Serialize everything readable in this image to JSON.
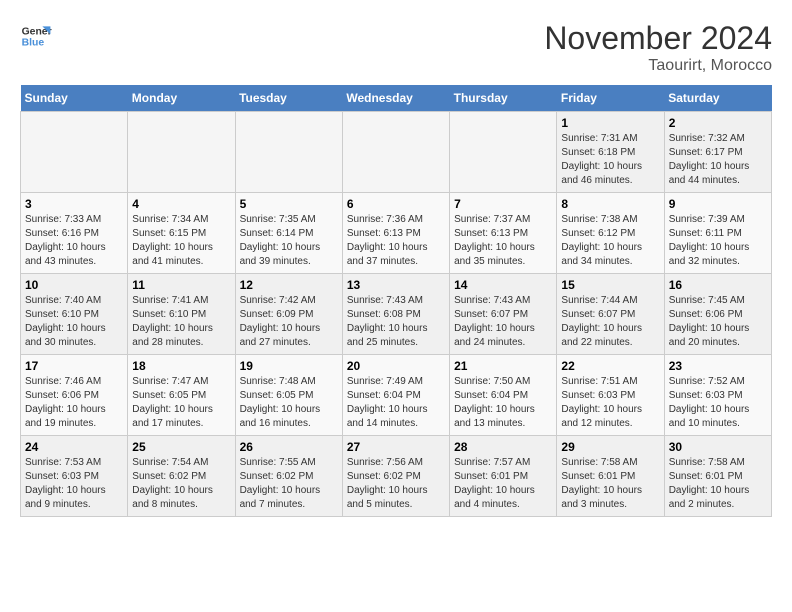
{
  "header": {
    "logo_line1": "General",
    "logo_line2": "Blue",
    "month": "November 2024",
    "location": "Taourirt, Morocco"
  },
  "weekdays": [
    "Sunday",
    "Monday",
    "Tuesday",
    "Wednesday",
    "Thursday",
    "Friday",
    "Saturday"
  ],
  "weeks": [
    [
      {
        "day": "",
        "info": ""
      },
      {
        "day": "",
        "info": ""
      },
      {
        "day": "",
        "info": ""
      },
      {
        "day": "",
        "info": ""
      },
      {
        "day": "",
        "info": ""
      },
      {
        "day": "1",
        "info": "Sunrise: 7:31 AM\nSunset: 6:18 PM\nDaylight: 10 hours and 46 minutes."
      },
      {
        "day": "2",
        "info": "Sunrise: 7:32 AM\nSunset: 6:17 PM\nDaylight: 10 hours and 44 minutes."
      }
    ],
    [
      {
        "day": "3",
        "info": "Sunrise: 7:33 AM\nSunset: 6:16 PM\nDaylight: 10 hours and 43 minutes."
      },
      {
        "day": "4",
        "info": "Sunrise: 7:34 AM\nSunset: 6:15 PM\nDaylight: 10 hours and 41 minutes."
      },
      {
        "day": "5",
        "info": "Sunrise: 7:35 AM\nSunset: 6:14 PM\nDaylight: 10 hours and 39 minutes."
      },
      {
        "day": "6",
        "info": "Sunrise: 7:36 AM\nSunset: 6:13 PM\nDaylight: 10 hours and 37 minutes."
      },
      {
        "day": "7",
        "info": "Sunrise: 7:37 AM\nSunset: 6:13 PM\nDaylight: 10 hours and 35 minutes."
      },
      {
        "day": "8",
        "info": "Sunrise: 7:38 AM\nSunset: 6:12 PM\nDaylight: 10 hours and 34 minutes."
      },
      {
        "day": "9",
        "info": "Sunrise: 7:39 AM\nSunset: 6:11 PM\nDaylight: 10 hours and 32 minutes."
      }
    ],
    [
      {
        "day": "10",
        "info": "Sunrise: 7:40 AM\nSunset: 6:10 PM\nDaylight: 10 hours and 30 minutes."
      },
      {
        "day": "11",
        "info": "Sunrise: 7:41 AM\nSunset: 6:10 PM\nDaylight: 10 hours and 28 minutes."
      },
      {
        "day": "12",
        "info": "Sunrise: 7:42 AM\nSunset: 6:09 PM\nDaylight: 10 hours and 27 minutes."
      },
      {
        "day": "13",
        "info": "Sunrise: 7:43 AM\nSunset: 6:08 PM\nDaylight: 10 hours and 25 minutes."
      },
      {
        "day": "14",
        "info": "Sunrise: 7:43 AM\nSunset: 6:07 PM\nDaylight: 10 hours and 24 minutes."
      },
      {
        "day": "15",
        "info": "Sunrise: 7:44 AM\nSunset: 6:07 PM\nDaylight: 10 hours and 22 minutes."
      },
      {
        "day": "16",
        "info": "Sunrise: 7:45 AM\nSunset: 6:06 PM\nDaylight: 10 hours and 20 minutes."
      }
    ],
    [
      {
        "day": "17",
        "info": "Sunrise: 7:46 AM\nSunset: 6:06 PM\nDaylight: 10 hours and 19 minutes."
      },
      {
        "day": "18",
        "info": "Sunrise: 7:47 AM\nSunset: 6:05 PM\nDaylight: 10 hours and 17 minutes."
      },
      {
        "day": "19",
        "info": "Sunrise: 7:48 AM\nSunset: 6:05 PM\nDaylight: 10 hours and 16 minutes."
      },
      {
        "day": "20",
        "info": "Sunrise: 7:49 AM\nSunset: 6:04 PM\nDaylight: 10 hours and 14 minutes."
      },
      {
        "day": "21",
        "info": "Sunrise: 7:50 AM\nSunset: 6:04 PM\nDaylight: 10 hours and 13 minutes."
      },
      {
        "day": "22",
        "info": "Sunrise: 7:51 AM\nSunset: 6:03 PM\nDaylight: 10 hours and 12 minutes."
      },
      {
        "day": "23",
        "info": "Sunrise: 7:52 AM\nSunset: 6:03 PM\nDaylight: 10 hours and 10 minutes."
      }
    ],
    [
      {
        "day": "24",
        "info": "Sunrise: 7:53 AM\nSunset: 6:03 PM\nDaylight: 10 hours and 9 minutes."
      },
      {
        "day": "25",
        "info": "Sunrise: 7:54 AM\nSunset: 6:02 PM\nDaylight: 10 hours and 8 minutes."
      },
      {
        "day": "26",
        "info": "Sunrise: 7:55 AM\nSunset: 6:02 PM\nDaylight: 10 hours and 7 minutes."
      },
      {
        "day": "27",
        "info": "Sunrise: 7:56 AM\nSunset: 6:02 PM\nDaylight: 10 hours and 5 minutes."
      },
      {
        "day": "28",
        "info": "Sunrise: 7:57 AM\nSunset: 6:01 PM\nDaylight: 10 hours and 4 minutes."
      },
      {
        "day": "29",
        "info": "Sunrise: 7:58 AM\nSunset: 6:01 PM\nDaylight: 10 hours and 3 minutes."
      },
      {
        "day": "30",
        "info": "Sunrise: 7:58 AM\nSunset: 6:01 PM\nDaylight: 10 hours and 2 minutes."
      }
    ]
  ]
}
